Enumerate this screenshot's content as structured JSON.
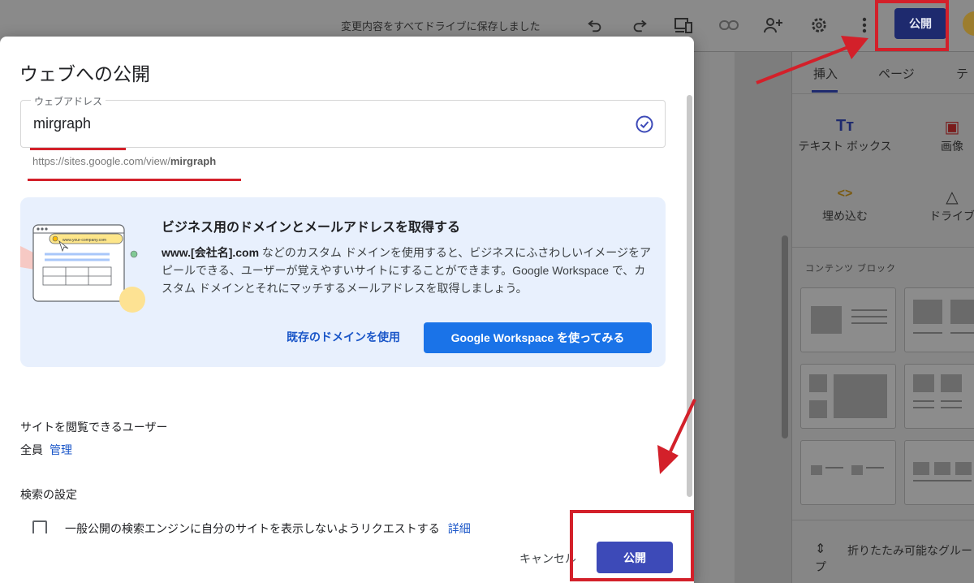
{
  "topbar": {
    "save_status": "変更内容をすべてドライブに保存しました",
    "icons": [
      "undo-icon",
      "redo-icon",
      "preview-icon",
      "link-icon",
      "share-icon",
      "gear-icon",
      "more-icon"
    ],
    "publish_label": "公開"
  },
  "right_panel": {
    "tabs": [
      {
        "label": "挿入"
      },
      {
        "label": "ページ"
      },
      {
        "label": "テ"
      }
    ],
    "tools": [
      {
        "label": "テキスト ボックス",
        "glyph": "Tт",
        "icon": "text-box-icon"
      },
      {
        "label": "画像",
        "glyph": "▣",
        "icon": "image-icon"
      },
      {
        "label": "埋め込む",
        "glyph": "<>",
        "icon": "embed-icon"
      },
      {
        "label": "ドライブ",
        "glyph": "△",
        "icon": "drive-icon"
      }
    ],
    "content_blocks_heading": "コンテンツ ブロック",
    "collapsible_label": "折りたたみ可能なグループ"
  },
  "dialog": {
    "title": "ウェブへの公開",
    "web_address": {
      "label": "ウェブアドレス",
      "value": "mirgraph",
      "url_prefix": "https://sites.google.com/view/",
      "url_slug": "mirgraph"
    },
    "promo": {
      "title": "ビジネス用のドメインとメールアドレスを取得する",
      "body_bold": "www.[会社名].com",
      "body_rest": " などのカスタム ドメインを使用すると、ビジネスにふさわしいイメージをアピールできる、ユーザーが覚えやすいサイトにすることができます。Google Workspace で、カスタム ドメインとそれにマッチするメールアドレスを取得しましょう。",
      "illustration_url": "www.your-company.com",
      "link_label": "既存のドメインを使用",
      "button_label": "Google Workspace を使ってみる"
    },
    "viewers": {
      "heading": "サイトを閲覧できるユーザー",
      "value": "全員",
      "manage_label": "管理"
    },
    "search": {
      "heading": "検索の設定",
      "checkbox_label": "一般公開の検索エンジンに自分のサイトを表示しないようリクエストする",
      "detail_label": "詳細",
      "checked": false
    },
    "footer": {
      "cancel_label": "キャンセル",
      "publish_label": "公開"
    }
  },
  "colors": {
    "annotation_red": "#d3202a",
    "primary_blue": "#1a73e8",
    "publish_blue": "#3d4ab8",
    "link_blue": "#1a56c8",
    "promo_bg": "#e8f0fd"
  }
}
